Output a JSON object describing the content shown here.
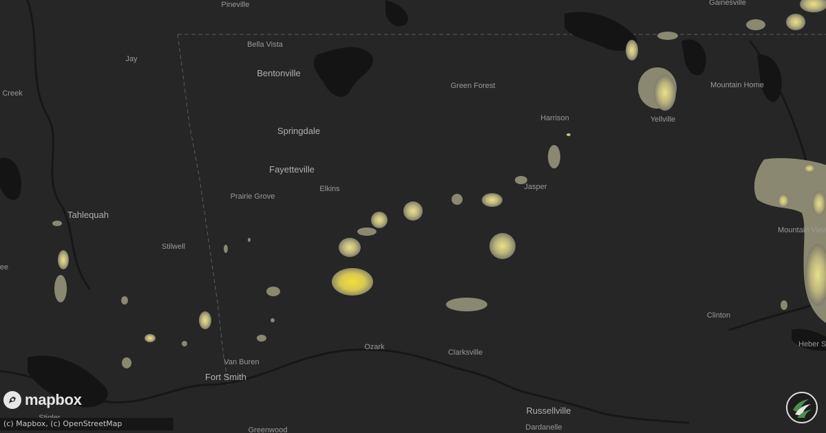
{
  "map": {
    "cities": [
      {
        "name": "Pineville",
        "big": false
      },
      {
        "name": "Bella Vista",
        "big": false
      },
      {
        "name": "Jay",
        "big": false
      },
      {
        "name": "Creek",
        "big": false
      },
      {
        "name": "Bentonville",
        "big": true
      },
      {
        "name": "Springdale",
        "big": true
      },
      {
        "name": "Fayetteville",
        "big": true
      },
      {
        "name": "Elkins",
        "big": false
      },
      {
        "name": "Prairie Grove",
        "big": false
      },
      {
        "name": "Tahlequah",
        "big": true
      },
      {
        "name": "Stilwell",
        "big": false
      },
      {
        "name": "Green Forest",
        "big": false
      },
      {
        "name": "Harrison",
        "big": false
      },
      {
        "name": "Jasper",
        "big": false
      },
      {
        "name": "Gainesville",
        "big": false
      },
      {
        "name": "Mountain Home",
        "big": false
      },
      {
        "name": "Yellville",
        "big": false
      },
      {
        "name": "Mountain View",
        "big": false
      },
      {
        "name": "Clinton",
        "big": false
      },
      {
        "name": "Heber S",
        "big": false
      },
      {
        "name": "Van Buren",
        "big": false
      },
      {
        "name": "Fort Smith",
        "big": true
      },
      {
        "name": "Ozark",
        "big": false
      },
      {
        "name": "Clarksville",
        "big": false
      },
      {
        "name": "Russellville",
        "big": true
      },
      {
        "name": "Dardanelle",
        "big": false
      },
      {
        "name": "Greenwood",
        "big": false
      },
      {
        "name": "Stigler",
        "big": false
      },
      {
        "name": "ee",
        "big": false
      }
    ],
    "colors": {
      "background": "#262626",
      "lake": "#141414",
      "river": "#1a1a1a",
      "border": "#5a5a5a",
      "hail_light": "#8a8870",
      "hail_mid": "#c8c07a",
      "hail_high": "#e8d84a"
    }
  },
  "branding": {
    "logo_text": "mapbox",
    "logo_icon": "mapbox-logo-icon",
    "badge_icon": "storm-badge-icon"
  },
  "attribution": "(c) Mapbox, (c) OpenStreetMap"
}
